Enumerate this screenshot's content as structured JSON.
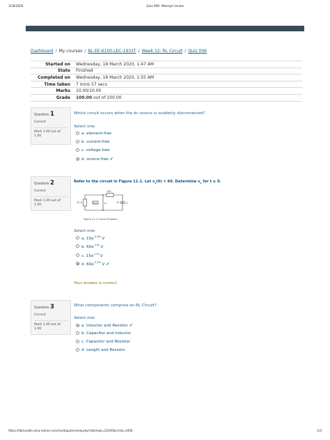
{
  "print": {
    "date": "3/18/2020",
    "title": "Quiz 006: Attempt review",
    "url": "https://tbmoodle.ama-online.com/mod/quiz/review.php?attempt=12345&cmid=3456",
    "page": "1/3"
  },
  "breadcrumb": {
    "dashboard": "Dashboard",
    "my_courses": "My courses",
    "course": "BL-EE-6100-LEC-1933T",
    "week": "Week 12: RL Circuit",
    "quiz": "Quiz 006"
  },
  "summary": [
    {
      "label": "Started on",
      "value": "Wednesday, 18 March 2020, 1:47 AM"
    },
    {
      "label": "State",
      "value": "Finished"
    },
    {
      "label": "Completed on",
      "value": "Wednesday, 18 March 2020, 1:55 AM"
    },
    {
      "label": "Time taken",
      "value": "7 mins 57 secs"
    },
    {
      "label": "Marks",
      "value": "10.00/10.00"
    },
    {
      "label": "Grade",
      "value_bold": "100.00",
      "value_rest": " out of 100.00"
    }
  ],
  "questions": [
    {
      "prefix": "Question",
      "number": "1",
      "status": "Correct",
      "mark": "Mark 1.00 out of 1.00",
      "text": "Which circuit occurs when the dc source is suddenly disconnected?",
      "select_one": "Select one:",
      "options": [
        {
          "label": "a. element-free",
          "selected": false
        },
        {
          "label": "b. current-free",
          "selected": false
        },
        {
          "label": "c. voltage-free",
          "selected": false
        },
        {
          "label": "d. source-free",
          "selected": true,
          "correct": true
        }
      ]
    },
    {
      "prefix": "Question",
      "number": "2",
      "status": "Correct",
      "mark": "Mark 1.00 out of 1.00",
      "text": "Refer to the circuit in Figure 11.1.  Let v",
      "text_sub": "c",
      "text_rest": "(0) = 60. Determine v",
      "text_sub2": "c",
      "text_end": " for t ≥ 0.",
      "figure_caption": "Figure 11.1  Circuit Problem",
      "figure_labels": {
        "left": "12 Ω",
        "mid": "6 Ω",
        "node": "v₀",
        "top": "8 Ω",
        "cap": "1F",
        "vc": "vᶜ"
      },
      "select_one": "Select one:",
      "options": [
        {
          "base": "a. 15e",
          "exp": "-0.25t",
          "unit": " V",
          "selected": false
        },
        {
          "base": "b. 60e",
          "exp": "-2.5t",
          "unit": " V",
          "selected": false
        },
        {
          "base": "c. 15e",
          "exp": "-2.5t",
          "unit": " V",
          "selected": false
        },
        {
          "base": "d. 60e",
          "exp": "-0.25t",
          "unit": " V",
          "selected": true,
          "correct": true
        }
      ],
      "feedback": "Your answer is correct."
    },
    {
      "prefix": "Question",
      "number": "3",
      "status": "Correct",
      "mark": "Mark 1.00 out of 1.00",
      "text": "What components comprise an RL Circuit?",
      "select_one": "Select one:",
      "options": [
        {
          "label": "a. Inductor and Resistor",
          "selected": true,
          "correct": true
        },
        {
          "label": "b. Capacitor and Inductor",
          "selected": false
        },
        {
          "label": "c. Capacitor and Resistor",
          "selected": false
        },
        {
          "label": "d. Length and Resistor",
          "selected": false
        }
      ]
    }
  ],
  "colors": {
    "topbar": "#3b4a55",
    "link": "#0b5e94",
    "check": "#1a8a3a"
  }
}
